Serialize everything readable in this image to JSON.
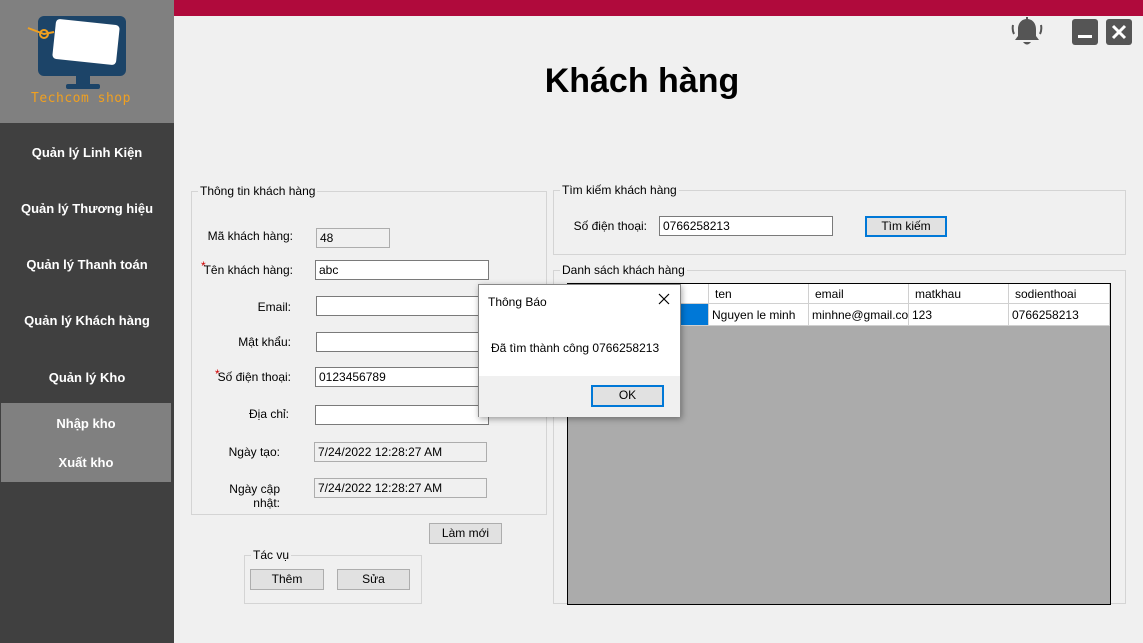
{
  "app": {
    "logo_text": "Techcom shop",
    "page_title": "Khách hàng",
    "colors": {
      "topbar": "#b00a3c",
      "sidebar": "#404040",
      "logo_text": "#f0a020",
      "focus_border": "#0078d7"
    },
    "icons": [
      "bell-icon",
      "minimize-icon",
      "close-icon",
      "logo-monitor-icon"
    ]
  },
  "sidebar": {
    "items": [
      {
        "label": "Quản lý Linh Kiện"
      },
      {
        "label": "Quản lý Thương hiệu"
      },
      {
        "label": "Quản lý Thanh toán"
      },
      {
        "label": "Quản lý Khách hàng"
      },
      {
        "label": "Quản lý Kho"
      }
    ],
    "submenu": [
      {
        "label": "Nhập kho"
      },
      {
        "label": "Xuất kho"
      }
    ]
  },
  "customer_info": {
    "title": "Thông tin khách hàng",
    "fields": {
      "id": {
        "label": "Mã khách hàng:",
        "value": "48"
      },
      "name": {
        "label": "Tên khách hàng:",
        "value": "abc",
        "required": "*"
      },
      "email": {
        "label": "Email:",
        "value": ""
      },
      "password": {
        "label": "Mật khẩu:",
        "value": ""
      },
      "phone": {
        "label": "Số điện thoại:",
        "value": "0123456789",
        "required": "*"
      },
      "address": {
        "label": "Địa chỉ:",
        "value": ""
      },
      "created": {
        "label": "Ngày tạo:",
        "value": "7/24/2022 12:28:27 AM"
      },
      "updated": {
        "label": "Ngày cập nhật:",
        "value": "7/24/2022 12:28:27 AM"
      }
    },
    "refresh_label": "Làm mới"
  },
  "actions": {
    "title": "Tác vụ",
    "add_label": "Thêm",
    "edit_label": "Sửa"
  },
  "search": {
    "title": "Tìm kiếm khách hàng",
    "phone_label": "Số điện thoại:",
    "phone_value": "0766258213",
    "button_label": "Tìm kiếm"
  },
  "customer_list": {
    "title": "Danh sách khách hàng",
    "columns": [
      "ten",
      "email",
      "matkhau",
      "sodienthoai"
    ],
    "rows": [
      {
        "ten": "Nguyen le minh",
        "email": "minhne@gmail.com",
        "matkhau": "123",
        "sodienthoai": "0766258213"
      }
    ]
  },
  "dialog": {
    "title": "Thông Báo",
    "message": "Đã tìm thành công 0766258213",
    "ok_label": "OK"
  }
}
